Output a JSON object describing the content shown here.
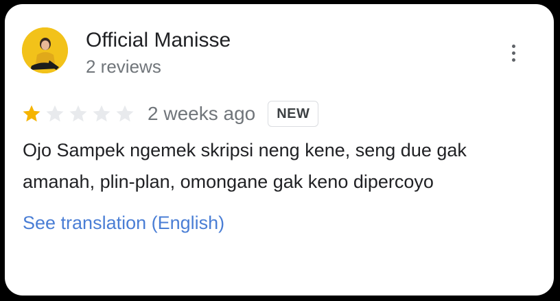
{
  "review": {
    "author_name": "Official Manisse",
    "author_meta": "2 reviews",
    "rating": 1,
    "rating_max": 5,
    "time_ago": "2 weeks ago",
    "badge": "NEW",
    "text": "Ojo Sampek ngemek skripsi neng kene, seng due gak amanah, plin-plan, omongane gak keno dipercoyo",
    "translate_link": "See translation (English)"
  },
  "icons": {
    "more": "more-vert-icon",
    "star": "star-icon"
  },
  "colors": {
    "star_filled": "#f5b400",
    "star_empty": "#e8eaed",
    "link": "#4a7ed5",
    "text_primary": "#202124",
    "text_secondary": "#70757a"
  }
}
